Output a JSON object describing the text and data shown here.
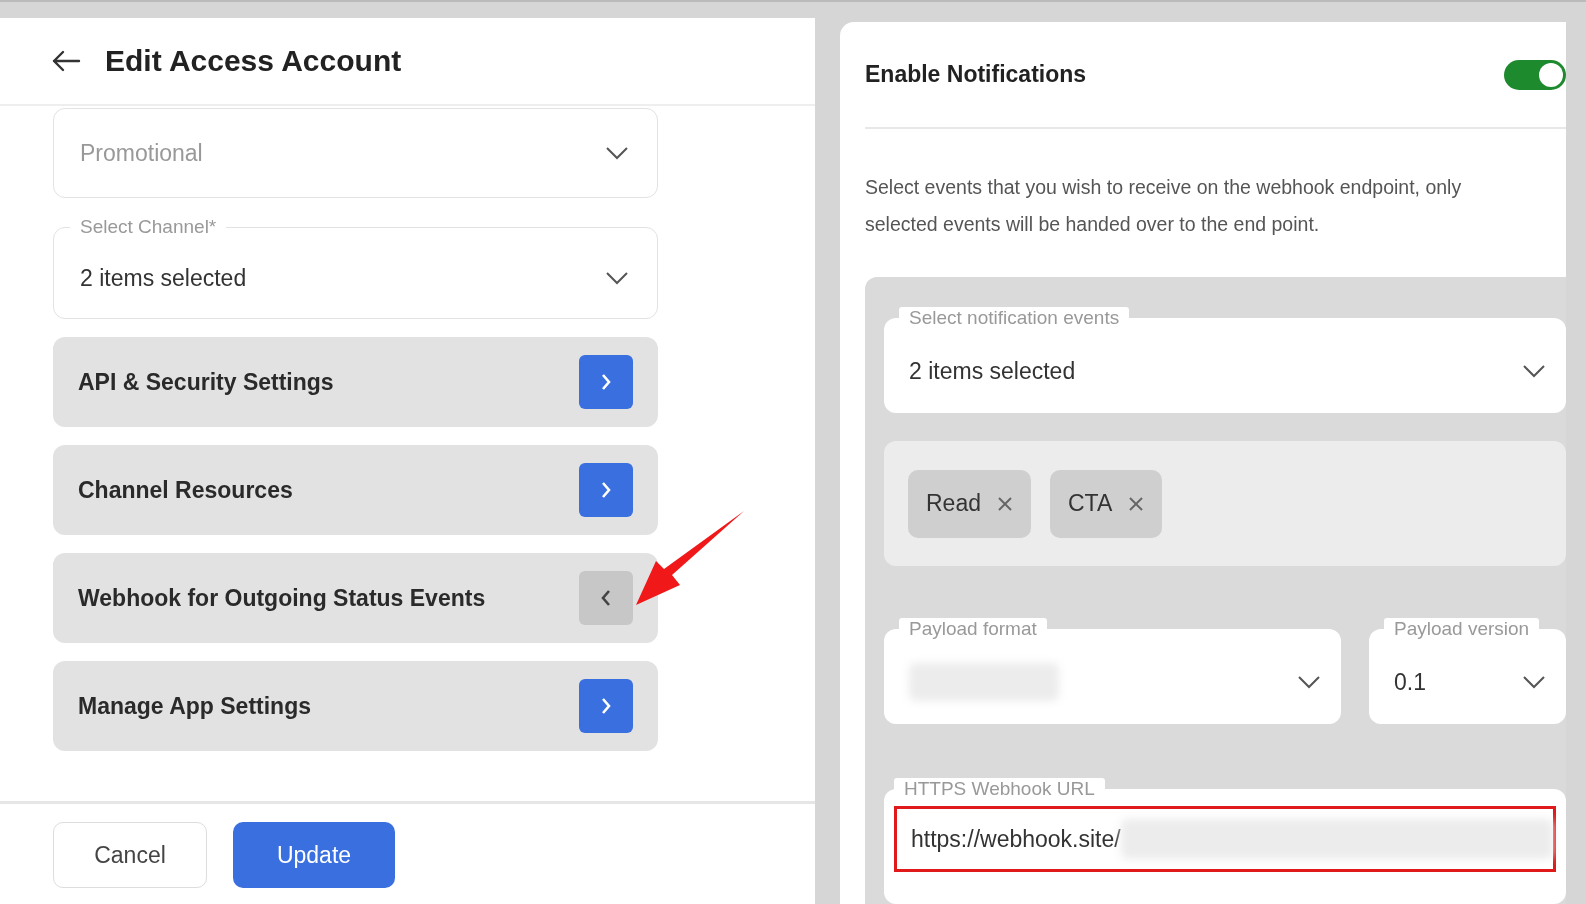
{
  "left_panel": {
    "title": "Edit Access Account",
    "fields": [
      {
        "value": "Promotional",
        "disabled": true
      },
      {
        "label": "Select Channel*",
        "value": "2 items selected",
        "disabled": false
      }
    ],
    "sections": [
      {
        "title": "API & Security Settings",
        "expanded": false
      },
      {
        "title": "Channel Resources",
        "expanded": false
      },
      {
        "title": "Webhook for Outgoing Status Events",
        "expanded": true
      },
      {
        "title": "Manage App Settings",
        "expanded": false
      }
    ],
    "buttons": [
      {
        "label": "Cancel",
        "kind": "secondary"
      },
      {
        "label": "Update",
        "kind": "primary"
      }
    ]
  },
  "right_panel": {
    "title": "Enable Notifications",
    "enabled": true,
    "description": "Select events that you wish to receive on the webhook endpoint, only selected events will be handed over to the end point.",
    "events_field": {
      "label": "Select notification events",
      "value": "2 items selected"
    },
    "chips": [
      {
        "label": "Read"
      },
      {
        "label": "CTA"
      }
    ],
    "payload_format": {
      "label": "Payload format"
    },
    "payload_version": {
      "label": "Payload version",
      "value": "0.1"
    },
    "webhook_url": {
      "label": "HTTPS Webhook URL",
      "value": "https://webhook.site/",
      "highlighted": true
    }
  }
}
